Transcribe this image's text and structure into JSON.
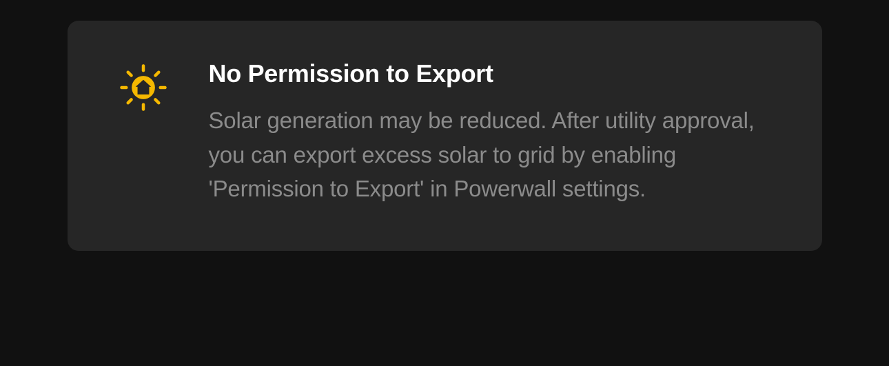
{
  "alert": {
    "title": "No Permission to Export",
    "description": "Solar generation may be reduced. After utility approval, you can export excess solar to grid by enabling 'Permission to Export' in Powerwall settings.",
    "icon": "solar-home-icon",
    "accent_color": "#f5b800"
  }
}
